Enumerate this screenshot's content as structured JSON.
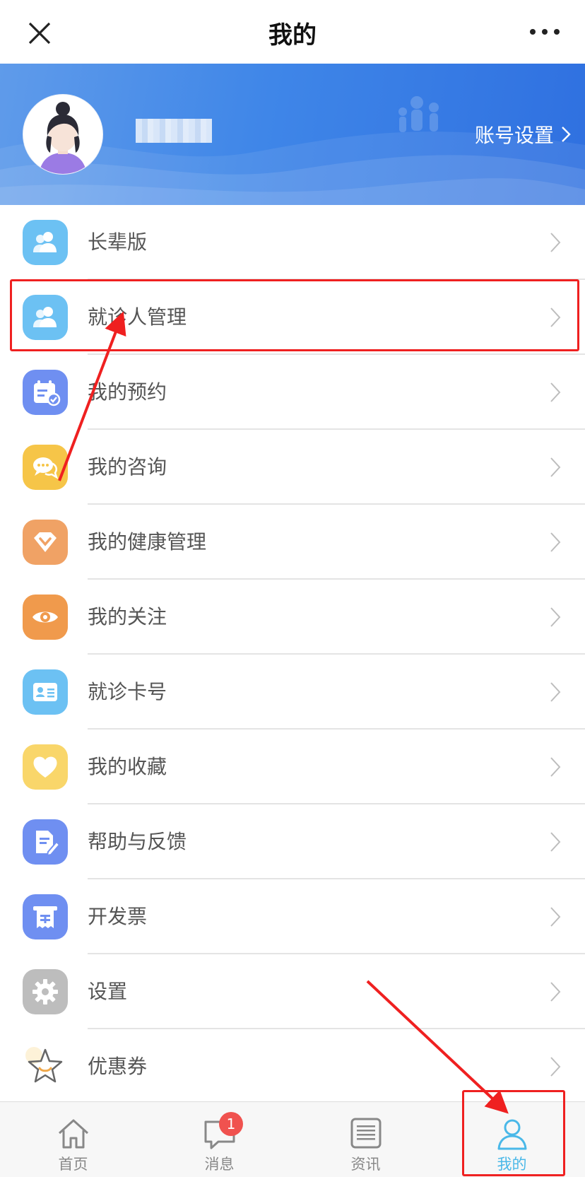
{
  "navbar": {
    "title": "我的",
    "close_icon": "close-icon",
    "more_icon": "more-icon"
  },
  "profile": {
    "account_settings_label": "账号设置"
  },
  "menu": [
    {
      "label": "长辈版",
      "icon": "users-icon",
      "color": "#6cc1f3"
    },
    {
      "label": "就诊人管理",
      "icon": "users-icon",
      "color": "#6cc1f3"
    },
    {
      "label": "我的预约",
      "icon": "calendar-check-icon",
      "color": "#6f8ff1"
    },
    {
      "label": "我的咨询",
      "icon": "chat-bubble-icon",
      "color": "#f6c548"
    },
    {
      "label": "我的健康管理",
      "icon": "diamond-check-icon",
      "color": "#f0a265"
    },
    {
      "label": "我的关注",
      "icon": "eye-icon",
      "color": "#f09a4c"
    },
    {
      "label": "就诊卡号",
      "icon": "id-card-icon",
      "color": "#6cc1f3"
    },
    {
      "label": "我的收藏",
      "icon": "heart-icon",
      "color": "#f9d66a"
    },
    {
      "label": "帮助与反馈",
      "icon": "edit-doc-icon",
      "color": "#6f8ff1"
    },
    {
      "label": "开发票",
      "icon": "invoice-icon",
      "color": "#6f8ff1"
    },
    {
      "label": "设置",
      "icon": "gear-icon",
      "color": "#bdbdbd"
    },
    {
      "label": "优惠券",
      "icon": "star-icon",
      "color": "#ffffff"
    }
  ],
  "tabbar": {
    "tabs": [
      {
        "label": "首页",
        "icon": "home-icon"
      },
      {
        "label": "消息",
        "icon": "message-icon"
      },
      {
        "label": "资讯",
        "icon": "news-icon"
      },
      {
        "label": "我的",
        "icon": "person-icon"
      }
    ],
    "message_badge": "1",
    "active_color": "#4ab8e8"
  },
  "annotation_color": "#ef2020"
}
